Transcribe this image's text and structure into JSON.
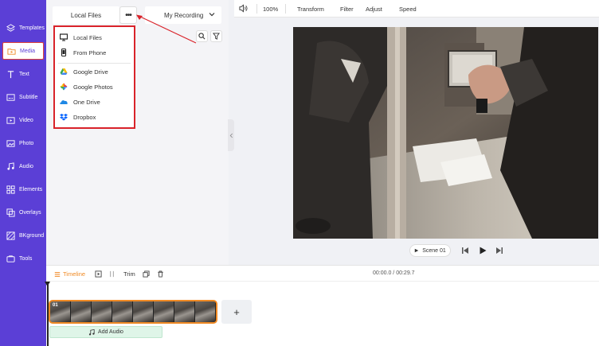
{
  "sidebar": {
    "items": [
      {
        "label": "Templates",
        "icon": "layers-icon"
      },
      {
        "label": "Media",
        "icon": "folder-play-icon",
        "active": true
      },
      {
        "label": "Text",
        "icon": "text-icon"
      },
      {
        "label": "Subtitle",
        "icon": "subtitle-icon"
      },
      {
        "label": "Video",
        "icon": "video-icon"
      },
      {
        "label": "Photo",
        "icon": "photo-icon"
      },
      {
        "label": "Audio",
        "icon": "music-icon"
      },
      {
        "label": "Elements",
        "icon": "elements-icon"
      },
      {
        "label": "Overlays",
        "icon": "overlays-icon"
      },
      {
        "label": "BKground",
        "icon": "background-icon"
      },
      {
        "label": "Tools",
        "icon": "tools-icon"
      }
    ]
  },
  "panel": {
    "tab_local": "Local Files",
    "more_label": "•••",
    "tab_recording": "My Recording"
  },
  "dropdown": {
    "items": [
      {
        "label": "Local Files",
        "icon": "monitor-icon"
      },
      {
        "label": "From Phone",
        "icon": "phone-icon"
      },
      {
        "label": "Google Drive",
        "icon": "google-drive-icon"
      },
      {
        "label": "Google Photos",
        "icon": "google-photos-icon"
      },
      {
        "label": "One Drive",
        "icon": "onedrive-icon"
      },
      {
        "label": "Dropbox",
        "icon": "dropbox-icon"
      }
    ]
  },
  "toolbar": {
    "zoom": "100%",
    "transform": "Transform",
    "filter": "Filter",
    "adjust": "Adjust",
    "speed": "Speed"
  },
  "player": {
    "scene": "Scene 01"
  },
  "timeline": {
    "label": "Timeline",
    "trim": "Trim",
    "time": "00:00.0 / 00:29.7",
    "clip_label": "01",
    "add": "+",
    "add_audio": "Add Audio"
  },
  "colors": {
    "sidebar": "#5b3fd6",
    "highlight": "#d9232a",
    "accent": "#f08a24"
  }
}
